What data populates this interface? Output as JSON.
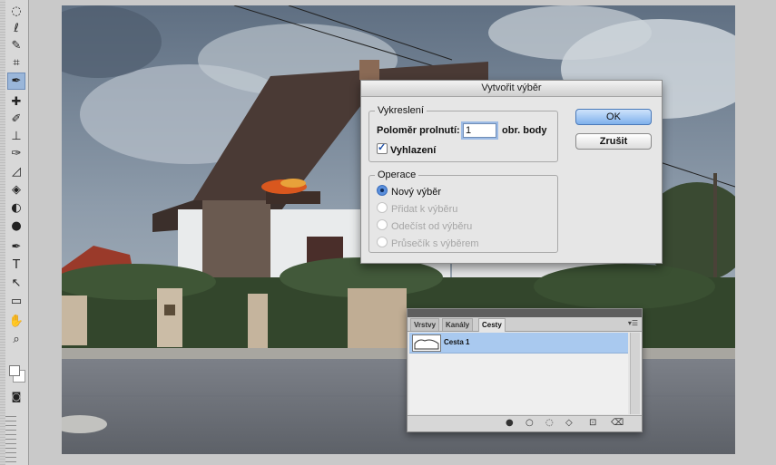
{
  "tools": {
    "items": [
      {
        "name": "elliptical-marquee-icon",
        "glyph": "◌"
      },
      {
        "name": "lasso-icon",
        "glyph": "ℓ"
      },
      {
        "name": "quick-selection-icon",
        "glyph": "✎"
      },
      {
        "name": "crop-icon",
        "glyph": "⌗"
      },
      {
        "name": "eyedropper-icon",
        "glyph": "✒"
      },
      {
        "name": "spot-healing-icon",
        "glyph": "✚"
      },
      {
        "name": "brush-icon",
        "glyph": "✐"
      },
      {
        "name": "clone-stamp-icon",
        "glyph": "⊥"
      },
      {
        "name": "history-brush-icon",
        "glyph": "✑"
      },
      {
        "name": "eraser-icon",
        "glyph": "◿"
      },
      {
        "name": "paint-bucket-icon",
        "glyph": "◈"
      },
      {
        "name": "blur-icon",
        "glyph": "◐"
      },
      {
        "name": "dodge-icon",
        "glyph": "●"
      },
      {
        "name": "pen-icon",
        "glyph": "✒"
      },
      {
        "name": "type-icon",
        "glyph": "T"
      },
      {
        "name": "path-selection-icon",
        "glyph": "↖"
      },
      {
        "name": "rectangle-icon",
        "glyph": "▭"
      },
      {
        "name": "hand-icon",
        "glyph": "✋"
      },
      {
        "name": "zoom-icon",
        "glyph": "⌕"
      }
    ],
    "active_index": 4
  },
  "dialog": {
    "title": "Vytvořit výběr",
    "rendering_legend": "Vykreslení",
    "feather_label": "Poloměr prolnutí:",
    "feather_value": "1",
    "feather_unit": "obr. body",
    "antialias_label": "Vyhlazení",
    "antialias_checked": true,
    "operation_legend": "Operace",
    "operations": [
      {
        "label": "Nový výběr",
        "selected": true,
        "enabled": true
      },
      {
        "label": "Přidat k výběru",
        "selected": false,
        "enabled": false
      },
      {
        "label": "Odečíst od výběru",
        "selected": false,
        "enabled": false
      },
      {
        "label": "Průsečík s výběrem",
        "selected": false,
        "enabled": false
      }
    ],
    "ok_label": "OK",
    "cancel_label": "Zrušit"
  },
  "paths_panel": {
    "tabs": [
      "Vrstvy",
      "Kanály",
      "Cesty"
    ],
    "active_tab": "Cesty",
    "items": [
      {
        "label": "Cesta 1",
        "selected": true
      }
    ],
    "footer_icons": [
      "fill-path-icon",
      "stroke-path-icon",
      "load-selection-icon",
      "make-work-path-icon",
      "new-path-icon",
      "delete-path-icon"
    ]
  },
  "colors": {
    "dialog_bg": "#e6e6e6",
    "ok_button": "#7fb0ec",
    "path_selected": "#a9c9ef"
  }
}
